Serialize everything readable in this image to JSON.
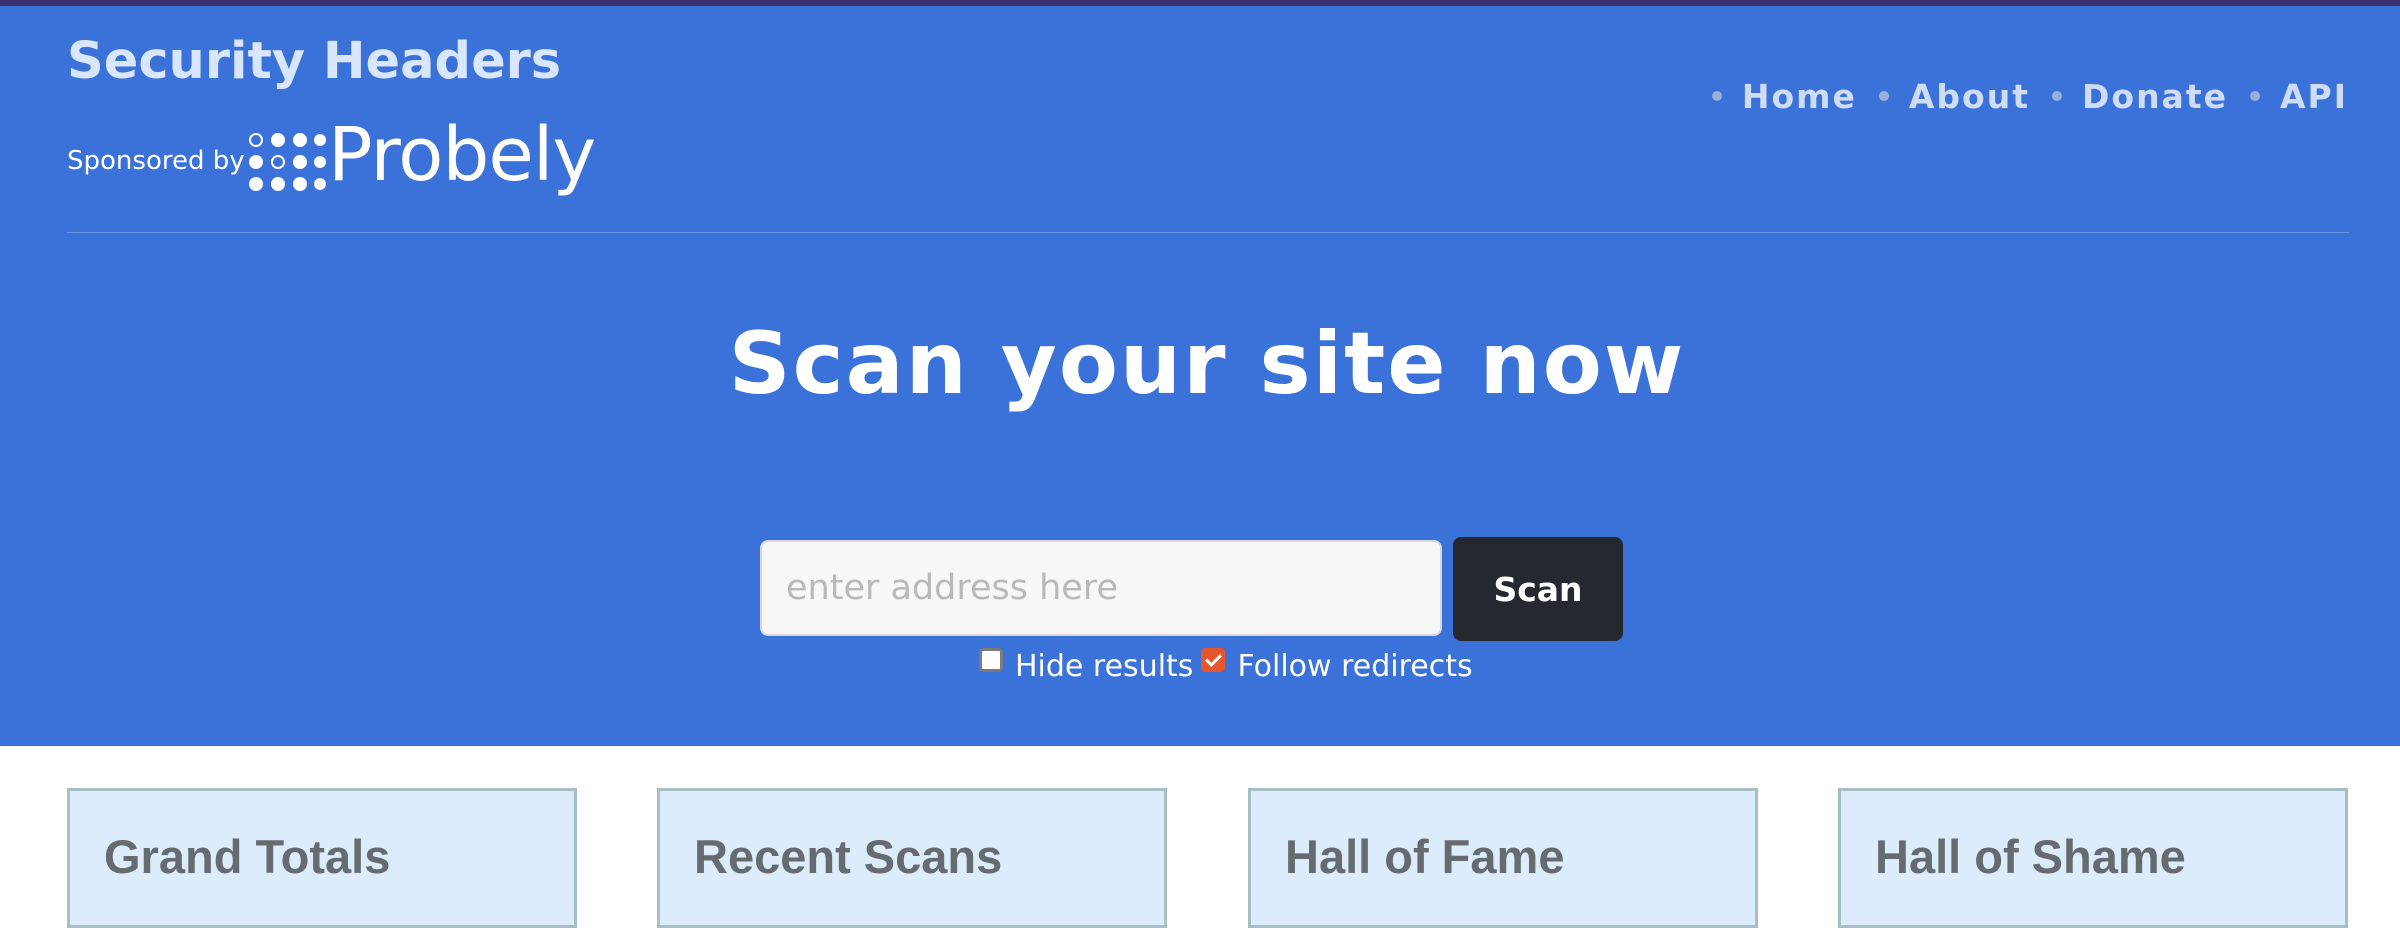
{
  "brand": {
    "title": "Security Headers",
    "sponsored_label": "Sponsored by",
    "sponsor_name": "Probely"
  },
  "nav": {
    "items": [
      {
        "label": "Home"
      },
      {
        "label": "About"
      },
      {
        "label": "Donate"
      },
      {
        "label": "API"
      }
    ]
  },
  "hero": {
    "headline": "Scan your site now",
    "address_placeholder": "enter address here",
    "address_value": "",
    "scan_label": "Scan",
    "hide_results_label": "Hide results",
    "hide_results_checked": false,
    "follow_redirects_label": "Follow redirects",
    "follow_redirects_checked": true
  },
  "cards": [
    {
      "title": "Grand Totals"
    },
    {
      "title": "Recent Scans"
    },
    {
      "title": "Hall of Fame"
    },
    {
      "title": "Hall of Shame"
    }
  ],
  "colors": {
    "hero_background": "#3b72d9",
    "scan_button": "#25282e",
    "checkbox_checked": "#e4572e",
    "card_background": "#dcecfc",
    "card_border": "#a6bfc4"
  },
  "icons": {
    "sponsor_logo": "probely-dots-logo",
    "checkbox_checked": "check-icon"
  }
}
